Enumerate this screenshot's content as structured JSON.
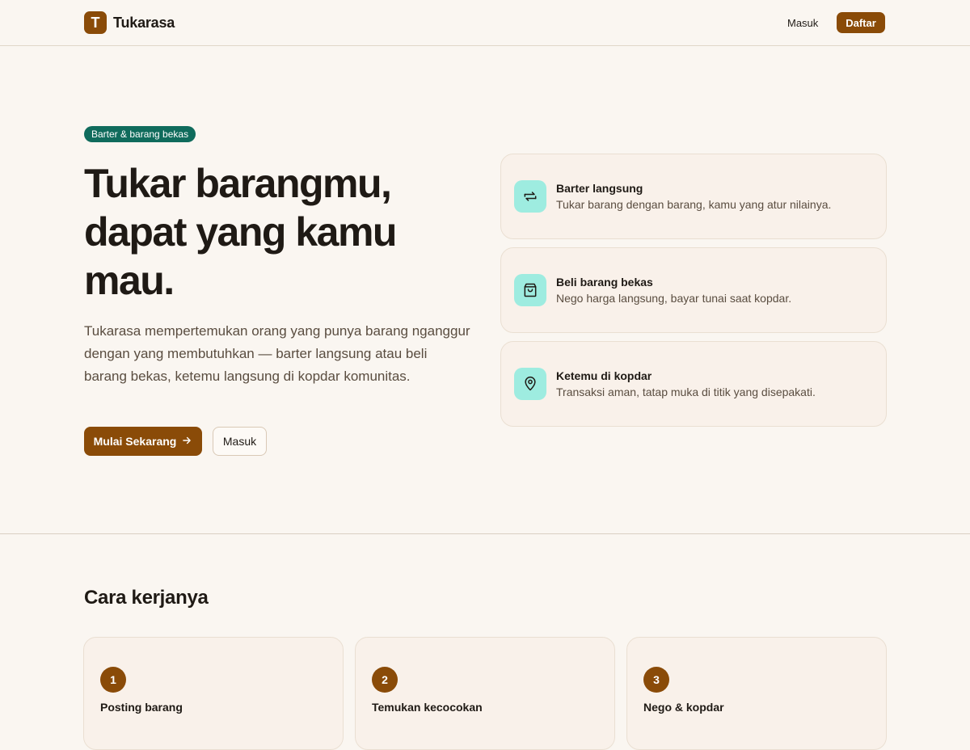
{
  "nav": {
    "brand_letter": "T",
    "brand_name": "Tukarasa",
    "login_label": "Masuk",
    "register_label": "Daftar"
  },
  "hero": {
    "badge": "Barter & barang bekas",
    "title": "Tukar barangmu, dapat yang kamu mau.",
    "description": "Tukarasa mempertemukan orang yang punya barang nganggur dengan yang membutuhkan — barter langsung atau beli barang bekas, ketemu langsung di kopdar komunitas.",
    "primary_button": "Mulai Sekarang",
    "secondary_button": "Masuk"
  },
  "features": [
    {
      "icon": "swap-arrows-icon",
      "title": "Barter langsung",
      "description": "Tukar barang dengan barang, kamu yang atur nilainya."
    },
    {
      "icon": "shopping-bag-icon",
      "title": "Beli barang bekas",
      "description": "Nego harga langsung, bayar tunai saat kopdar."
    },
    {
      "icon": "map-pin-icon",
      "title": "Ketemu di kopdar",
      "description": "Transaksi aman, tatap muka di titik yang disepakati."
    }
  ],
  "how_it_works": {
    "title": "Cara kerjanya",
    "steps": [
      {
        "number": "1",
        "title": "Posting barang",
        "description": ""
      },
      {
        "number": "2",
        "title": "Temukan kecocokan",
        "description": ""
      },
      {
        "number": "3",
        "title": "Nego & kopdar",
        "description": ""
      }
    ]
  },
  "colors": {
    "background": "#faf6f1",
    "brand": "#8a4b08",
    "badge": "#0f6b5c",
    "icon_bg": "#9eece0"
  }
}
